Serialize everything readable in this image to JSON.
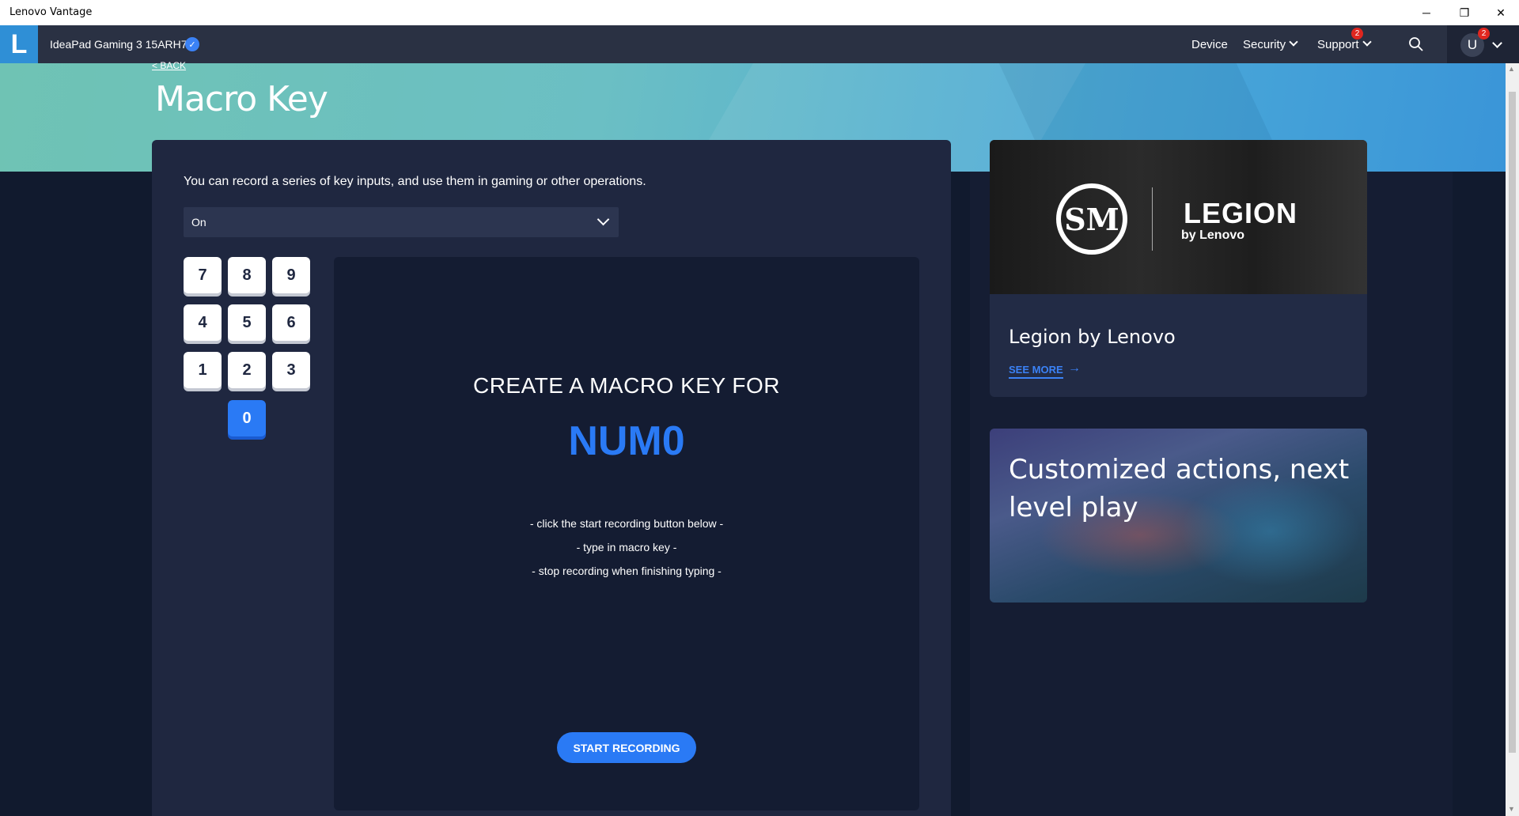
{
  "window": {
    "title": "Lenovo Vantage",
    "minimize": "─",
    "maximize": "❐",
    "close": "✕"
  },
  "topnav": {
    "logo_letter": "L",
    "device_name": "IdeaPad Gaming 3 15ARH7",
    "verified_icon": "✓",
    "items": [
      {
        "label": "Device"
      },
      {
        "label": "Security"
      },
      {
        "label": "Support",
        "badge": "2"
      }
    ],
    "user_initial": "U",
    "user_badge": "2"
  },
  "page": {
    "back_label": "< BACK",
    "title": "Macro Key",
    "description": "You can record a series of key inputs, and use them in gaming or other operations.",
    "dropdown_value": "On"
  },
  "keypad": {
    "keys": [
      "7",
      "8",
      "9",
      "4",
      "5",
      "6",
      "1",
      "2",
      "3",
      "0"
    ],
    "selected": "0"
  },
  "record": {
    "heading": "CREATE A MACRO KEY FOR",
    "key_name": "NUM0",
    "instructions": [
      "- click the start recording button below -",
      "- type in macro key -",
      "- stop recording when finishing typing -"
    ],
    "button_label": "START RECORDING"
  },
  "cards": {
    "legion": {
      "logo_tsm": "SM",
      "logo_word": "LEGION",
      "logo_sub": "by Lenovo",
      "title": "Legion by Lenovo",
      "link": "SEE MORE",
      "link_arrow": "→"
    },
    "promo": {
      "title": "Customized actions, next level play"
    }
  },
  "colors": {
    "accent": "#2a7af5",
    "nav_bg": "#2a3143",
    "panel_bg": "#1f2740",
    "record_bg": "#141c32",
    "badge": "#e0261f"
  }
}
